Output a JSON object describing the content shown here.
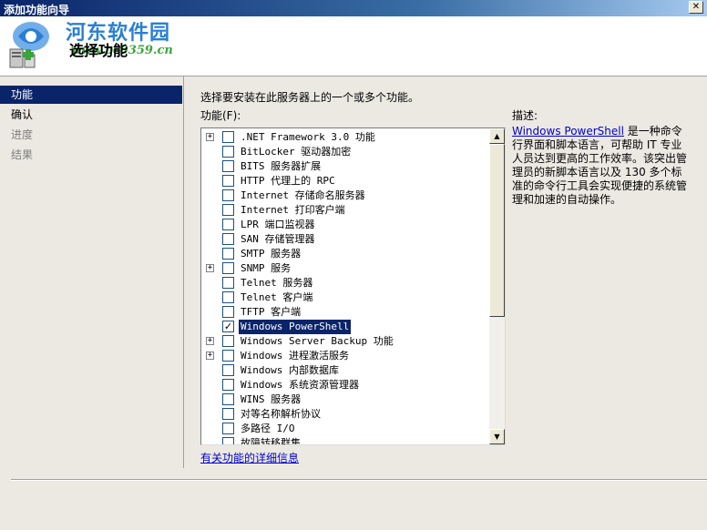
{
  "window": {
    "title": "添加功能向导",
    "close_glyph": "✕"
  },
  "watermark": {
    "name": "河东软件园",
    "url": "www.pc0359.cn"
  },
  "header": {
    "title": "选择功能",
    "icon": "server-features-icon"
  },
  "nav": {
    "items": [
      {
        "label": "功能",
        "state": "selected"
      },
      {
        "label": "确认",
        "state": "normal"
      },
      {
        "label": "进度",
        "state": "disabled"
      },
      {
        "label": "结果",
        "state": "disabled"
      }
    ]
  },
  "content": {
    "instruction": "选择要安装在此服务器上的一个或多个功能。",
    "list_label": "功能(F):",
    "description_label": "描述:",
    "description_link": "Windows PowerShell",
    "description_text": " 是一种命令行界面和脚本语言，可帮助 IT 专业人员达到更高的工作效率。该突出管理员的新脚本语言以及 130 多个标准的命令行工具会实现便捷的系统管理和加速的自动操作。",
    "more_info_link": "有关功能的详细信息"
  },
  "features": [
    {
      "label": ".NET Framework 3.0 功能",
      "expandable": true,
      "checked": false,
      "selected": false
    },
    {
      "label": "BitLocker 驱动器加密",
      "expandable": false,
      "checked": false,
      "selected": false
    },
    {
      "label": "BITS 服务器扩展",
      "expandable": false,
      "checked": false,
      "selected": false
    },
    {
      "label": "HTTP 代理上的 RPC",
      "expandable": false,
      "checked": false,
      "selected": false
    },
    {
      "label": "Internet 存储命名服务器",
      "expandable": false,
      "checked": false,
      "selected": false
    },
    {
      "label": "Internet 打印客户端",
      "expandable": false,
      "checked": false,
      "selected": false
    },
    {
      "label": "LPR 端口监视器",
      "expandable": false,
      "checked": false,
      "selected": false
    },
    {
      "label": "SAN 存储管理器",
      "expandable": false,
      "checked": false,
      "selected": false
    },
    {
      "label": "SMTP 服务器",
      "expandable": false,
      "checked": false,
      "selected": false
    },
    {
      "label": "SNMP 服务",
      "expandable": true,
      "checked": false,
      "selected": false
    },
    {
      "label": "Telnet 服务器",
      "expandable": false,
      "checked": false,
      "selected": false
    },
    {
      "label": "Telnet 客户端",
      "expandable": false,
      "checked": false,
      "selected": false
    },
    {
      "label": "TFTP 客户端",
      "expandable": false,
      "checked": false,
      "selected": false
    },
    {
      "label": "Windows PowerShell",
      "expandable": false,
      "checked": true,
      "selected": true
    },
    {
      "label": "Windows Server Backup 功能",
      "expandable": true,
      "checked": false,
      "selected": false
    },
    {
      "label": "Windows 进程激活服务",
      "expandable": true,
      "checked": false,
      "selected": false
    },
    {
      "label": "Windows 内部数据库",
      "expandable": false,
      "checked": false,
      "selected": false
    },
    {
      "label": "Windows 系统资源管理器",
      "expandable": false,
      "checked": false,
      "selected": false
    },
    {
      "label": "WINS 服务器",
      "expandable": false,
      "checked": false,
      "selected": false
    },
    {
      "label": "对等名称解析协议",
      "expandable": false,
      "checked": false,
      "selected": false
    },
    {
      "label": "多路径 I/O",
      "expandable": false,
      "checked": false,
      "selected": false
    },
    {
      "label": "故障转移群集",
      "expandable": false,
      "checked": false,
      "selected": false
    }
  ],
  "glyphs": {
    "expand": "+",
    "check": "✓",
    "scroll_up": "▲",
    "scroll_down": "▼"
  },
  "colors": {
    "selection": "#0a246a",
    "link": "#0000cc",
    "title_gradient_start": "#0a246a"
  }
}
